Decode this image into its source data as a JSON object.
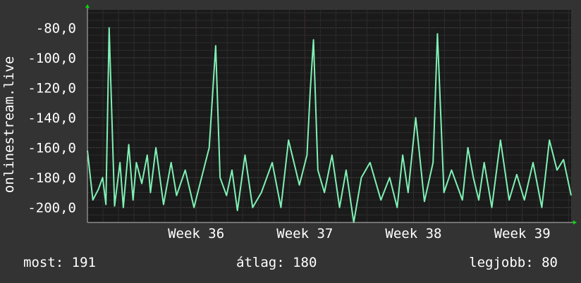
{
  "chart_data": {
    "type": "line",
    "ylabel": "onlinestream.live",
    "y_ticks": [
      "-80,0",
      "-100,0",
      "-120,0",
      "-140,0",
      "-160,0",
      "-180,0",
      "-200,0"
    ],
    "y_tick_values": [
      -80,
      -100,
      -120,
      -140,
      -160,
      -180,
      -200
    ],
    "ylim": [
      -210,
      -68
    ],
    "x_ticks": [
      "Week 36",
      "Week 37",
      "Week 38",
      "Week 39"
    ],
    "x_tick_positions_week": [
      36,
      37,
      38,
      39
    ],
    "xlim_week": [
      35.0,
      39.45
    ],
    "grid": true,
    "series": [
      {
        "color": "#7ff0b4",
        "x_week": [
          35.0,
          35.05,
          35.1,
          35.14,
          35.17,
          35.2,
          35.25,
          35.3,
          35.33,
          35.38,
          35.42,
          35.45,
          35.5,
          35.55,
          35.58,
          35.63,
          35.7,
          35.77,
          35.82,
          35.9,
          35.98,
          36.05,
          36.12,
          36.18,
          36.22,
          36.28,
          36.33,
          36.38,
          36.45,
          36.52,
          36.6,
          36.7,
          36.78,
          36.85,
          36.95,
          37.02,
          37.05,
          37.08,
          37.12,
          37.18,
          37.25,
          37.32,
          37.38,
          37.45,
          37.52,
          37.6,
          37.7,
          37.78,
          37.85,
          37.9,
          37.95,
          38.02,
          38.1,
          38.18,
          38.22,
          38.28,
          38.35,
          38.45,
          38.5,
          38.55,
          38.6,
          38.65,
          38.72,
          38.8,
          38.88,
          38.95,
          39.02,
          39.1,
          39.18,
          39.25,
          39.32,
          39.38,
          39.45
        ],
        "values": [
          -162,
          -195,
          -188,
          -180,
          -198,
          -80,
          -199,
          -170,
          -200,
          -158,
          -195,
          -170,
          -184,
          -165,
          -190,
          -160,
          -198,
          -170,
          -192,
          -175,
          -200,
          -180,
          -160,
          -92,
          -180,
          -192,
          -175,
          -202,
          -165,
          -200,
          -190,
          -170,
          -200,
          -155,
          -185,
          -165,
          -122,
          -88,
          -175,
          -190,
          -165,
          -200,
          -175,
          -210,
          -180,
          -170,
          -195,
          -180,
          -200,
          -165,
          -190,
          -140,
          -196,
          -170,
          -84,
          -190,
          -175,
          -195,
          -160,
          -180,
          -195,
          -170,
          -200,
          -155,
          -195,
          -178,
          -195,
          -170,
          -200,
          -155,
          -175,
          -168,
          -192
        ]
      }
    ]
  },
  "stats": {
    "now": "most: 191",
    "avg": "átlag: 180",
    "best": "legjobb: 80"
  },
  "colors": {
    "background": "#333333",
    "plot_background": "#1a1a1a",
    "grid": "#3e3e3e",
    "line": "#7ff0b4",
    "arrow": "#00dd00"
  }
}
